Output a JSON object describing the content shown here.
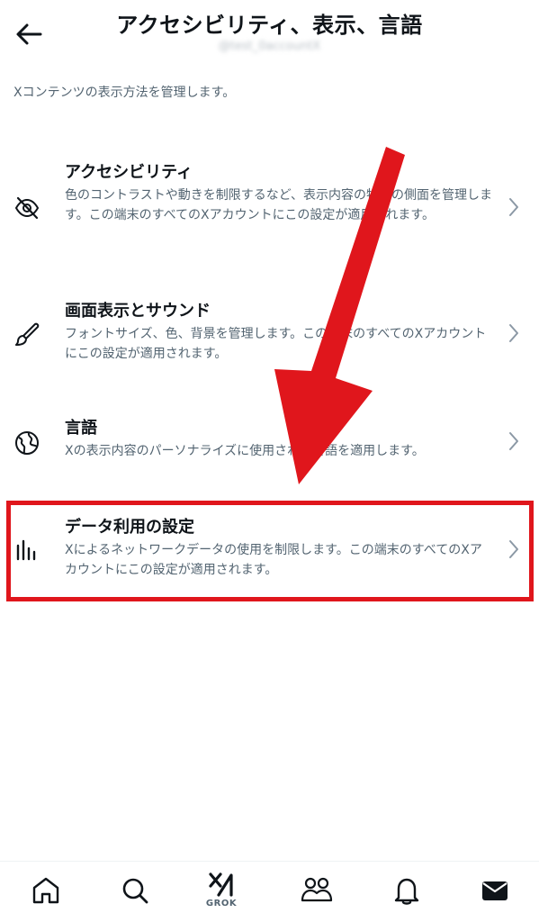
{
  "header": {
    "title": "アクセシビリティ、表示、言語",
    "handle": "@test_0accountX",
    "back_icon": "arrow-left-icon"
  },
  "description": "Xコンテンツの表示方法を管理します。",
  "items": [
    {
      "title": "アクセシビリティ",
      "subtitle": "色のコントラストや動きを制限するなど、表示内容の特定の側面を管理します。この端末のすべてのXアカウントにこの設定が適用されます。",
      "icon": "eye-slash-icon"
    },
    {
      "title": "画面表示とサウンド",
      "subtitle": "フォントサイズ、色、背景を管理します。この端末のすべてのXアカウントにこの設定が適用されます。",
      "icon": "brush-icon"
    },
    {
      "title": "言語",
      "subtitle": "Xの表示内容のパーソナライズに使用される言語を適用します。",
      "icon": "globe-icon"
    },
    {
      "title": "データ利用の設定",
      "subtitle": "Xによるネットワークデータの使用を制限します。この端末のすべてのXアカウントにこの設定が適用されます。",
      "icon": "bar-chart-icon"
    }
  ],
  "nav": {
    "grok_label": "GROK"
  },
  "colors": {
    "highlight": "#e0161c",
    "text_primary": "#0f1419",
    "text_secondary": "#536471"
  }
}
